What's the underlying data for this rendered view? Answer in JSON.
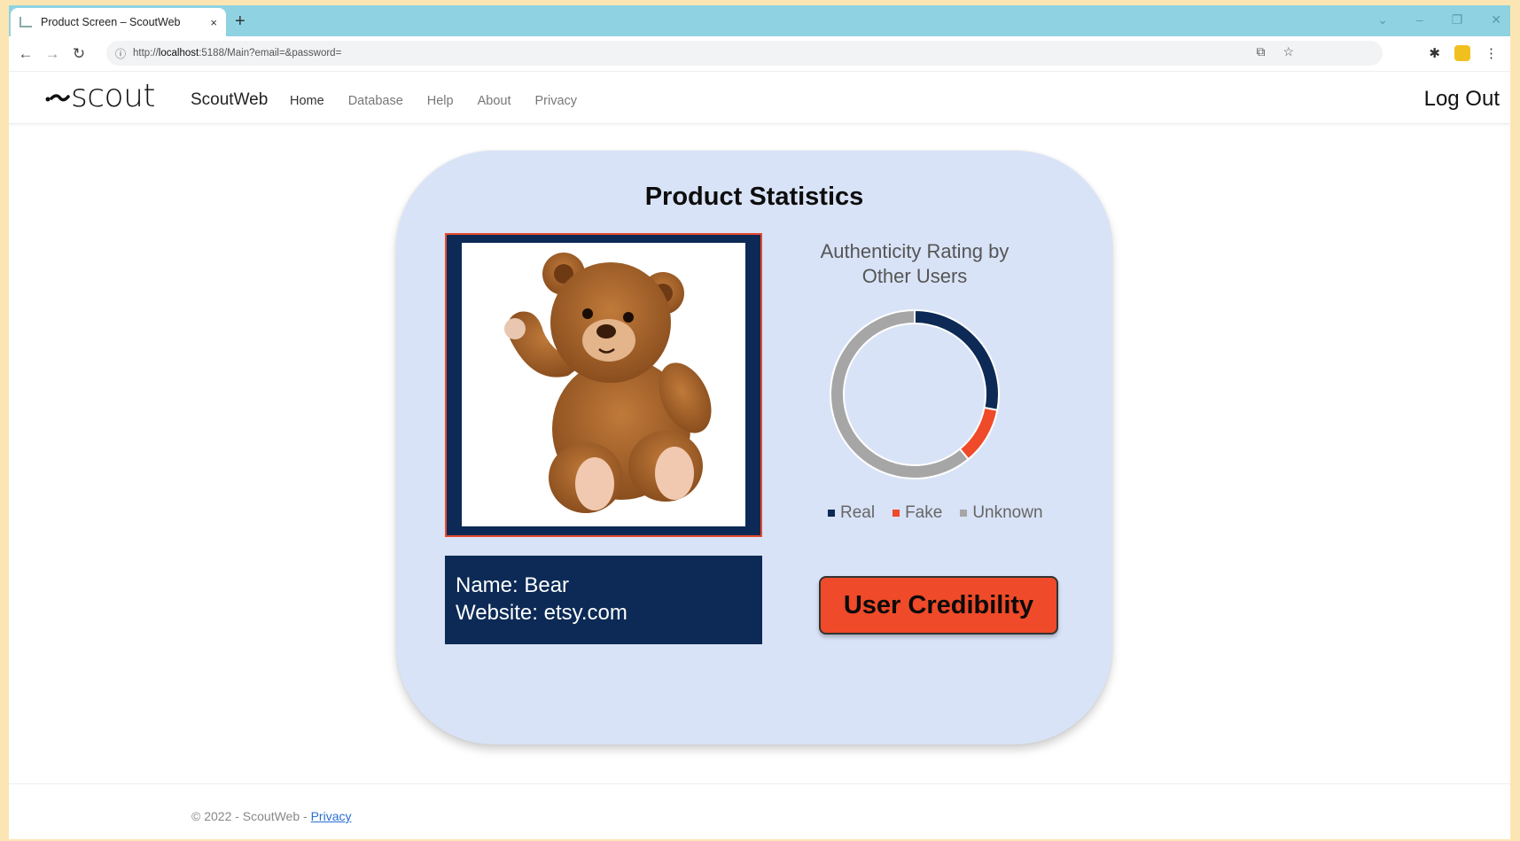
{
  "browser": {
    "tab_title": "Product Screen – ScoutWeb",
    "tab_close": "×",
    "new_tab": "+",
    "url_prefix": "http://",
    "url_host": "localhost",
    "url_rest": ":5188/Main?email=&password="
  },
  "site": {
    "logo_text": "scout",
    "brand": "ScoutWeb",
    "nav": [
      "Home",
      "Database",
      "Help",
      "About",
      "Privacy"
    ],
    "logout": "Log Out"
  },
  "card": {
    "title": "Product Statistics",
    "name_line": "Name: Bear",
    "website_line": "Website: etsy.com",
    "chart_title": "Authenticity Rating by Other Users",
    "button_label": "User Credibility"
  },
  "chart_data": {
    "type": "pie",
    "title": "Authenticity Rating by Other Users",
    "categories": [
      "Real",
      "Fake",
      "Unknown"
    ],
    "values": [
      28,
      11,
      61
    ],
    "colors": [
      "#0c2a55",
      "#ef4a29",
      "#a6a6a6"
    ],
    "legend": "bottom"
  },
  "footer": {
    "copyright": "© 2022 - ScoutWeb - ",
    "privacy_link": "Privacy"
  },
  "colors": {
    "navy": "#0c2a55",
    "accent": "#ef4a29",
    "card_bg": "#d9e3f7"
  }
}
